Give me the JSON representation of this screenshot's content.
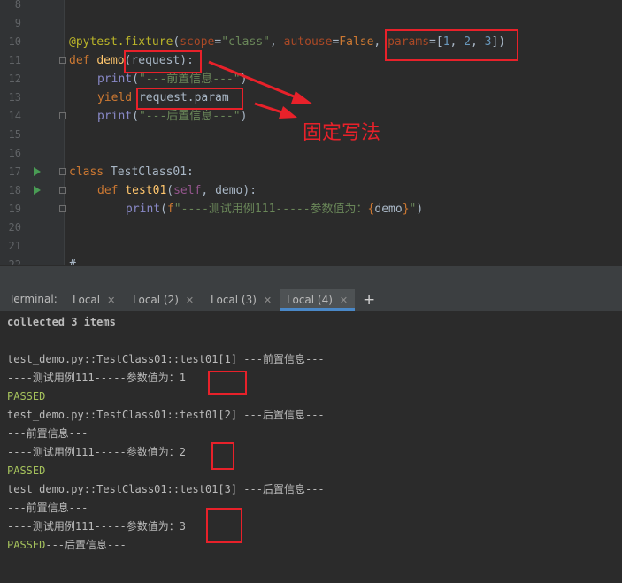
{
  "editor": {
    "lines": [
      {
        "num": "8"
      },
      {
        "num": "9"
      },
      {
        "num": "10"
      },
      {
        "num": "11"
      },
      {
        "num": "12"
      },
      {
        "num": "13"
      },
      {
        "num": "14"
      },
      {
        "num": "15"
      },
      {
        "num": "16"
      },
      {
        "num": "17"
      },
      {
        "num": "18"
      },
      {
        "num": "19"
      },
      {
        "num": "20"
      },
      {
        "num": "21"
      },
      {
        "num": "22"
      }
    ],
    "code": {
      "l10_decorator": "@pytest.fixture",
      "l10_scope_kw": "scope",
      "l10_scope_val": "\"class\"",
      "l10_autouse_kw": "autouse",
      "l10_autouse_val": "False",
      "l10_params_kw": "params",
      "l10_p1": "1",
      "l10_p2": "2",
      "l10_p3": "3",
      "l11_def": "def",
      "l11_name": "demo",
      "l11_args": "(request):",
      "l12_print": "print",
      "l12_str": "\"---前置信息---\"",
      "l13_yield": "yield",
      "l13_expr": "request.param",
      "l14_print": "print",
      "l14_str": "\"---后置信息---\"",
      "l17_class": "class",
      "l17_name": "TestClass01:",
      "l18_def": "def",
      "l18_name": "test01",
      "l18_self": "self",
      "l18_rest": ", demo):",
      "l19_print": "print",
      "l19_prefix": "f",
      "l19_str": "\"----测试用例111-----参数值为：",
      "l19_expr": "demo",
      "l19_end": "\""
    },
    "annotation": "固定写法"
  },
  "terminal": {
    "label": "Terminal:",
    "tabs": [
      {
        "label": "Local"
      },
      {
        "label": "Local (2)"
      },
      {
        "label": "Local (3)"
      },
      {
        "label": "Local (4)"
      }
    ],
    "active_tab": "Local (4)",
    "new_tab": "+",
    "output": [
      "collected 3 items",
      "",
      "test_demo.py::TestClass01::test01[1] ---前置信息---",
      "----测试用例111-----参数值为：1",
      "PASSED",
      "test_demo.py::TestClass01::test01[2] ---后置信息---",
      "---前置信息---",
      "----测试用例111-----参数值为：2",
      "PASSED",
      "test_demo.py::TestClass01::test01[3] ---后置信息---",
      "---前置信息---",
      "----测试用例111-----参数值为：3",
      "PASSED",
      "---后置信息---"
    ]
  },
  "colors": {
    "highlight_box": "#e8212a",
    "passed": "#a5c25c",
    "active_tab_underline": "#4a88c7"
  }
}
